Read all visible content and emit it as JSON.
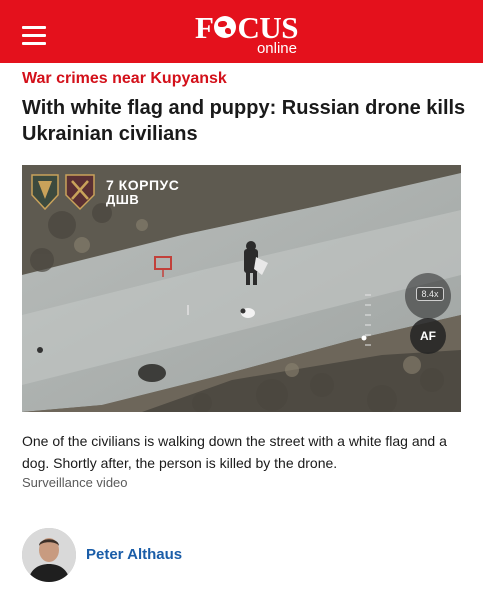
{
  "header": {
    "logo_main_left": "F",
    "logo_main_right": "CUS",
    "logo_sub": "online",
    "menu_icon": "hamburger-menu-icon"
  },
  "article": {
    "kicker": "War crimes near Kupyansk",
    "headline": "With white flag and puppy: Russian drone kills Ukrainian civilians",
    "video": {
      "overlay_unit_line1": "7 КОРПУС",
      "overlay_unit_line2": "ДШВ",
      "zoom_badge": "8.4x",
      "af_button": "AF"
    },
    "caption": "One of the civilians is walking down the street with a white flag and a dog. Shortly after, the person is killed by the drone.",
    "credit": "Surveillance video"
  },
  "author": {
    "name": "Peter Althaus"
  },
  "colors": {
    "brand_red": "#e4111c",
    "kicker_red": "#d3101a",
    "author_link": "#1a5da8"
  }
}
